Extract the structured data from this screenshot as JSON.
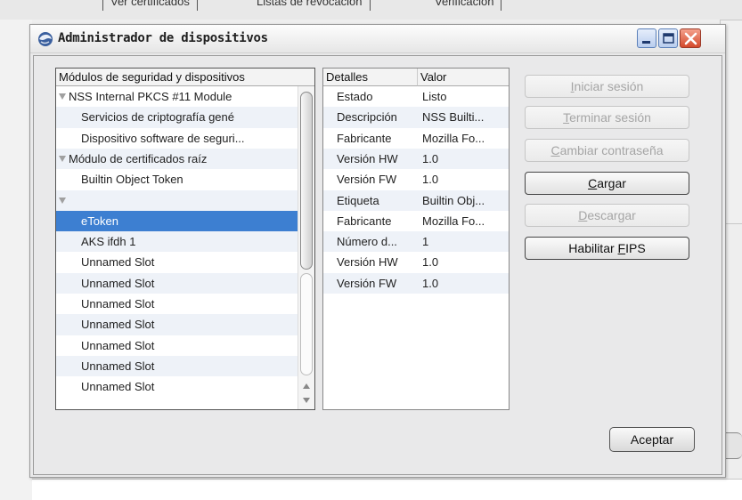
{
  "background": {
    "tabs": [
      "Ver certificados",
      "Listas de revocación",
      "Verificación"
    ]
  },
  "dialog": {
    "title": "Administrador de dispositivos",
    "icon": "thunderbird-logo-icon"
  },
  "modules": {
    "header": "Módulos de seguridad y dispositivos",
    "rows": [
      {
        "label": "NSS Internal PKCS #11 Module",
        "level": 0,
        "expanded": true
      },
      {
        "label": "Servicios de criptografía gené",
        "level": 1
      },
      {
        "label": "Dispositivo software de seguri...",
        "level": 1
      },
      {
        "label": "Módulo de certificados raíz",
        "level": 0,
        "expanded": true
      },
      {
        "label": "Builtin Object Token",
        "level": 1
      },
      {
        "label": "",
        "level": 0,
        "expanded": true
      },
      {
        "label": "eToken",
        "level": 1,
        "selected": true
      },
      {
        "label": "AKS ifdh 1",
        "level": 1
      },
      {
        "label": "Unnamed Slot",
        "level": 1
      },
      {
        "label": "Unnamed Slot",
        "level": 1
      },
      {
        "label": "Unnamed Slot",
        "level": 1
      },
      {
        "label": "Unnamed Slot",
        "level": 1
      },
      {
        "label": "Unnamed Slot",
        "level": 1
      },
      {
        "label": "Unnamed Slot",
        "level": 1
      },
      {
        "label": "Unnamed Slot",
        "level": 1
      }
    ]
  },
  "details": {
    "header_key": "Detalles",
    "header_value": "Valor",
    "rows": [
      {
        "key": "Estado",
        "value": "Listo"
      },
      {
        "key": "Descripción",
        "value": "NSS Builti..."
      },
      {
        "key": "Fabricante",
        "value": "Mozilla Fo..."
      },
      {
        "key": "Versión HW",
        "value": "1.0"
      },
      {
        "key": "Versión FW",
        "value": "1.0"
      },
      {
        "key": "Etiqueta",
        "value": "Builtin Obj..."
      },
      {
        "key": "Fabricante",
        "value": "Mozilla Fo..."
      },
      {
        "key": "Número d...",
        "value": "1"
      },
      {
        "key": "Versión HW",
        "value": "1.0"
      },
      {
        "key": "Versión FW",
        "value": "1.0"
      }
    ]
  },
  "buttons": {
    "login": {
      "label": "Iniciar sesión",
      "enabled": false
    },
    "logout": {
      "label": "Terminar sesión",
      "enabled": false
    },
    "change_password": {
      "label": "Cambiar contraseña",
      "enabled": false
    },
    "load": {
      "label": "Cargar",
      "enabled": true
    },
    "unload": {
      "label": "Descargar",
      "enabled": false
    },
    "enable_fips": {
      "label": "Habilitar FIPS",
      "enabled": true
    },
    "ok": {
      "label": "Aceptar"
    }
  },
  "colors": {
    "selection": "#3d7fd1",
    "alt_row": "#eef2f8",
    "close_button": "#d4492b"
  }
}
